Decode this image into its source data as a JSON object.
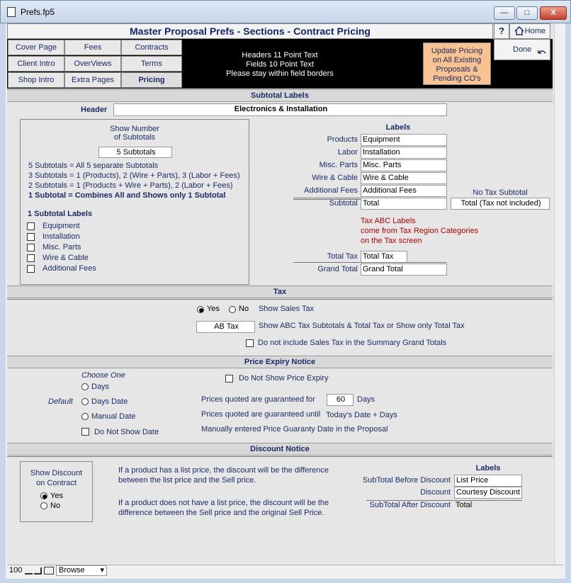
{
  "window": {
    "title": "Prefs.fp5",
    "min": "—",
    "max": "□",
    "close": "X"
  },
  "header": {
    "title": "Master Proposal Prefs - Sections - Contract Pricing",
    "help": "?",
    "home": "Home",
    "done": "Done"
  },
  "tabs": [
    {
      "label": "Cover Page"
    },
    {
      "label": "Fees"
    },
    {
      "label": "Contracts"
    },
    {
      "label": "Client Intro"
    },
    {
      "label": "OverViews"
    },
    {
      "label": "Terms"
    },
    {
      "label": "Shop Intro"
    },
    {
      "label": "Extra Pages"
    },
    {
      "label": "Pricing"
    }
  ],
  "notes": {
    "line1": "Headers 11 Point Text",
    "line2": "Fields 10 Point Text",
    "line3": "Please stay within field borders"
  },
  "update_button": {
    "line1": "Update Pricing",
    "line2": "on All Existing",
    "line3": "Proposals &",
    "line4": "Pending CO's"
  },
  "subtotal_labels": {
    "section": "Subtotal Labels",
    "header_label": "Header",
    "header_value": "Electronics & Installation",
    "show_number_l1": "Show Number",
    "show_number_l2": "of Subtotals",
    "show_number_value": "5 Subtotals",
    "opt1": "5  Subtotals = All 5 separate Subtotals",
    "opt2": "3  Subtotals = 1 (Products),  2 (Wire + Parts),  3 (Labor + Fees)",
    "opt3": "2  Subtotals = 1 (Products + Wire + Parts),  2 (Labor + Fees)",
    "opt4": "1  Subtotal   = Combines All and Shows only 1 Subtotal",
    "one_subtotal_labels": "1 Subtotal Labels",
    "checks": [
      "Equipment",
      "Installation",
      "Misc. Parts",
      "Wire & Cable",
      "Additional Fees"
    ],
    "labels_title": "Labels",
    "rows": [
      {
        "label": "Products",
        "value": "Equipment"
      },
      {
        "label": "Labor",
        "value": "Installation"
      },
      {
        "label": "Misc. Parts",
        "value": "Misc. Parts"
      },
      {
        "label": "Wire & Cable",
        "value": "Wire & Cable"
      },
      {
        "label": "Additional Fees",
        "value": "Additional Fees"
      },
      {
        "label": "Subtotal",
        "value": "Total"
      }
    ],
    "no_tax_title": "No Tax Subtotal",
    "no_tax_value": "Total (Tax not included)",
    "tax_note1": "Tax ABC Labels",
    "tax_note2": "come from Tax Region Categories",
    "tax_note3": "on the Tax screen",
    "total_tax_label": "Total Tax",
    "total_tax_value": "Total Tax",
    "grand_total_label": "Grand Total",
    "grand_total_value": "Grand Total"
  },
  "tax": {
    "section": "Tax",
    "yes": "Yes",
    "no": "No",
    "show_sales_tax": "Show Sales Tax",
    "ab_value": "AB Tax",
    "ab_desc": "Show ABC Tax Subtotals & Total Tax or Show only Total Tax",
    "exclude": "Do not include Sales Tax in the Summary Grand Totals"
  },
  "expiry": {
    "section": "Price Expiry Notice",
    "choose_one": "Choose One",
    "default_label": "Default",
    "opt_days": "Days",
    "opt_days_date": "Days Date",
    "opt_manual": "Manual Date",
    "do_not_show_date": "Do Not Show Date",
    "do_not_show_expiry": "Do Not Show Price Expiry",
    "guaranteed_for": "Prices quoted are guaranteed for",
    "days_value": "60",
    "days_label": "Days",
    "guaranteed_until": "Prices quoted are guaranteed until",
    "until_value": "Today's Date + Days",
    "manual_desc": "Manually entered Price Guaranty Date in the Proposal"
  },
  "discount": {
    "section": "Discount Notice",
    "show_l1": "Show Discount",
    "show_l2": "on Contract",
    "yes": "Yes",
    "no": "No",
    "p1_l1": "If a product has a list price, the discount will be the difference",
    "p1_l2": "between the list price and the Sell price.",
    "p2_l1": "If a product does not have a list price, the discount will be the",
    "p2_l2": "difference between the Sell price and the original Sell Price.",
    "labels_title": "Labels",
    "before_label": "SubTotal Before Discount",
    "before_value": "List Price",
    "discount_label": "Discount",
    "discount_value": "Courtesy Discount",
    "after_label": "SubTotal After Discount",
    "after_value": "Total"
  },
  "statusbar": {
    "zoom": "100",
    "mode": "Browse"
  }
}
